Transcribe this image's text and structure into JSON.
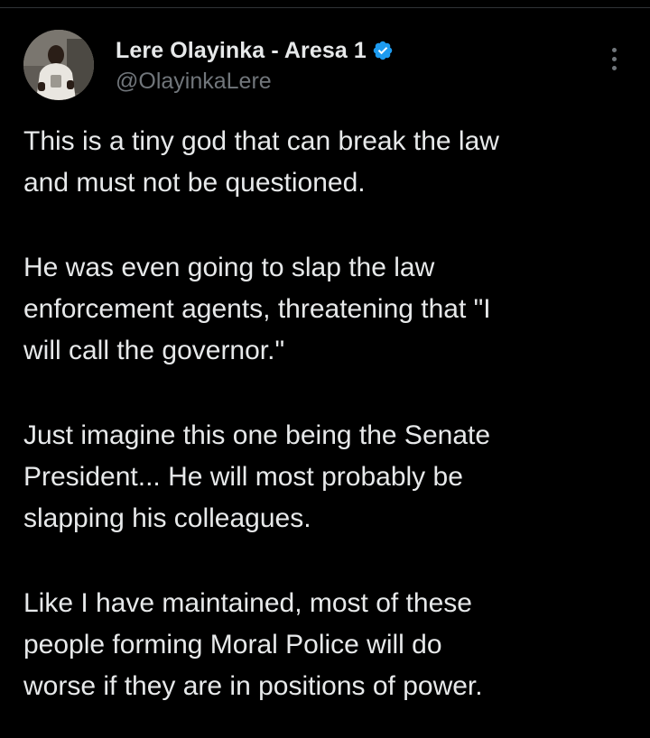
{
  "tweet": {
    "author": {
      "display_name": "Lere Olayinka - Aresa 1",
      "handle": "@OlayinkaLere",
      "verified": true,
      "avatar_icon": "profile-photo",
      "verified_icon": "verified-badge-icon",
      "verified_color": "#1d9bf0"
    },
    "menu_icon": "more-vertical-icon",
    "paragraphs": [
      "This is a tiny god that can break the law\nand must not be questioned.",
      "He was even going to slap the law\nenforcement agents, threatening that \"I\nwill call the governor.\"",
      "Just imagine this one being the Senate\nPresident... He will most probably be\nslapping his colleagues.",
      "Like I have maintained,  most of these\npeople forming Moral Police will do\nworse if they are in positions of power."
    ]
  },
  "colors": {
    "background": "#000000",
    "text_primary": "#e7e9ea",
    "text_secondary": "#71767b",
    "divider": "#2f3336"
  }
}
